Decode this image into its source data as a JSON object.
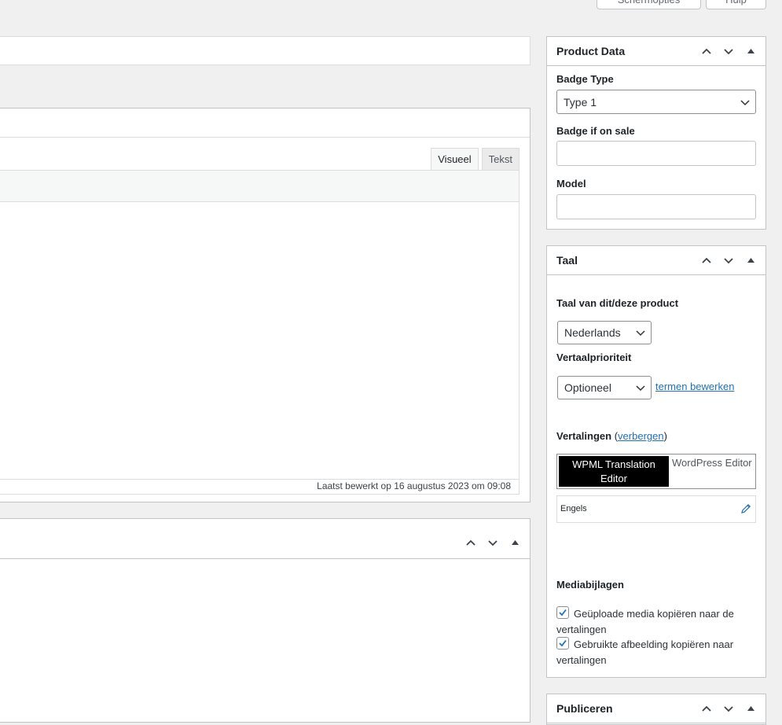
{
  "screen_options_label": "Schermopties",
  "help_label": "Hulp",
  "editor": {
    "tab_visual": "Visueel",
    "tab_text": "Tekst",
    "last_edited": "Laatst bewerkt op 16 augustus 2023 om 09:08"
  },
  "product_data": {
    "title": "Product Data",
    "badge_type_label": "Badge Type",
    "badge_type_value": "Type 1",
    "badge_sale_label": "Badge if on sale",
    "badge_sale_value": "",
    "model_label": "Model",
    "model_value": ""
  },
  "taal": {
    "title": "Taal",
    "language_label": "Taal van dit/deze product",
    "language_value": "Nederlands",
    "priority_label": "Vertaalprioriteit",
    "priority_value": "Optioneel",
    "edit_terms_link": "termen bewerken",
    "translations_label": "Vertalingen",
    "hide_link": "verbergen",
    "editor_option_active": "WPML Translation Editor",
    "editor_option_other": "WordPress Editor",
    "translation_language": "Engels",
    "media_label": "Mediabijlagen",
    "checkbox_1": "Geüploade media kopiëren naar de vertalingen",
    "checkbox_2": "Gebruikte afbeelding kopiëren naar vertalingen",
    "checkbox_1_checked": true,
    "checkbox_2_checked": true
  },
  "publish": {
    "title": "Publiceren"
  },
  "icons": {
    "up": "chevron-up-icon",
    "down": "chevron-down-icon",
    "toggle": "triangle-up-icon",
    "edit": "pencil-icon"
  },
  "colors": {
    "link": "#2271b1",
    "active_segment": "#000000"
  }
}
